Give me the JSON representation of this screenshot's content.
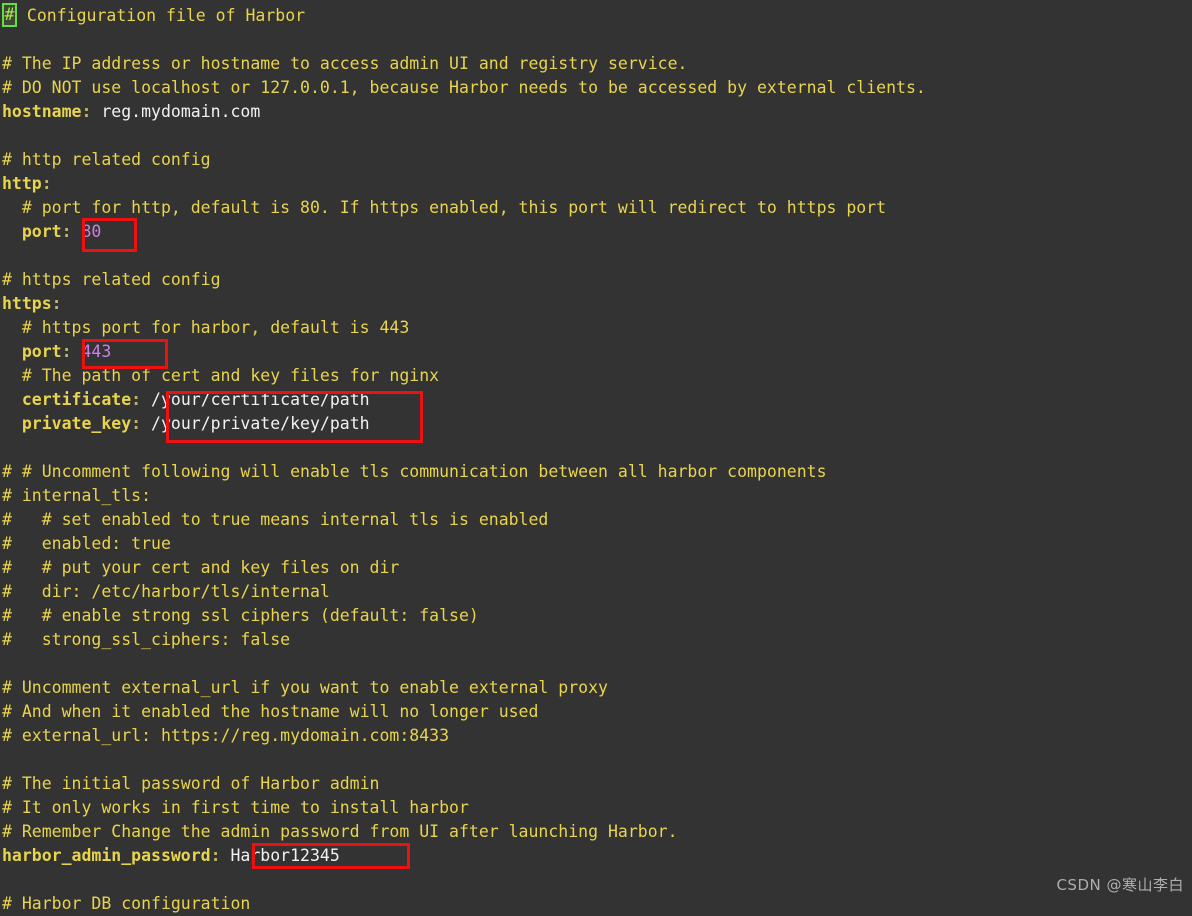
{
  "editor": {
    "background_color": "#333333",
    "comment_color": "#e8d44d",
    "key_color": "#e8d44d",
    "string_color": "#f2f2f2",
    "number_color": "#cc7fe6",
    "annotation_color": "#ee1111",
    "match_highlight_color": "#66dd44"
  },
  "lines": {
    "l1_hash": "#",
    "l1_text": " Configuration file of Harbor",
    "l3": "# The IP address or hostname to access admin UI and registry service.",
    "l4": "# DO NOT use localhost or 127.0.0.1, because Harbor needs to be accessed by external clients.",
    "l5_key": "hostname",
    "l5_colon": ":",
    "l5_value": "reg.mydomain.com",
    "l7": "# http related config",
    "l8_key": "http",
    "l8_colon": ":",
    "l9": "  # port for http, default is 80. If https enabled, this port will redirect to https port",
    "l10_indent": "  ",
    "l10_key": "port",
    "l10_colon": ":",
    "l10_value": "80",
    "l12": "# https related config",
    "l13_key": "https",
    "l13_colon": ":",
    "l14": "  # https port for harbor, default is 443",
    "l15_indent": "  ",
    "l15_key": "port",
    "l15_colon": ":",
    "l15_value": "443",
    "l16": "  # The path of cert and key files for nginx",
    "l17_indent": "  ",
    "l17_key": "certificate",
    "l17_colon": ":",
    "l17_value": "/your/certificate/path",
    "l18_indent": "  ",
    "l18_key": "private_key",
    "l18_colon": ":",
    "l18_value": "/your/private/key/path",
    "l20": "# # Uncomment following will enable tls communication between all harbor components",
    "l21": "# internal_tls:",
    "l22": "#   # set enabled to true means internal tls is enabled",
    "l23": "#   enabled: true",
    "l24": "#   # put your cert and key files on dir",
    "l25": "#   dir: /etc/harbor/tls/internal",
    "l26": "#   # enable strong ssl ciphers (default: false)",
    "l27": "#   strong_ssl_ciphers: false",
    "l29": "# Uncomment external_url if you want to enable external proxy",
    "l30": "# And when it enabled the hostname will no longer used",
    "l31": "# external_url: https://reg.mydomain.com:8433",
    "l33": "# The initial password of Harbor admin",
    "l34": "# It only works in first time to install harbor",
    "l35": "# Remember Change the admin password from UI after launching Harbor.",
    "l36_key": "harbor_admin_password",
    "l36_colon": ":",
    "l36_value": "Harbor12345",
    "l38": "# Harbor DB configuration"
  },
  "annotations": {
    "http_port_box": "80",
    "https_port_box": "443",
    "cert_key_box": "/your/certificate/path and /your/private/key/path",
    "admin_password_box": "Harbor12345"
  },
  "watermark": {
    "text": "CSDN @寒山李白"
  }
}
